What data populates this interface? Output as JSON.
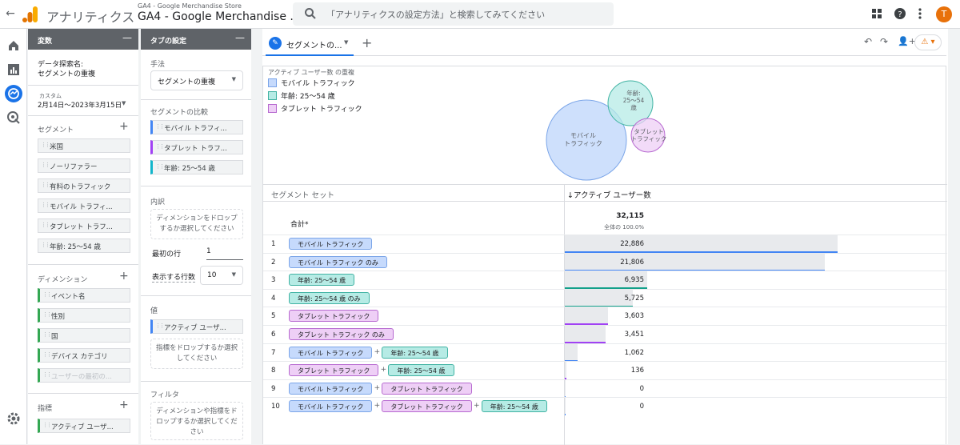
{
  "topbar": {
    "back_icon": "arrow-back-icon",
    "app_name": "アナリティクス",
    "property_sub": "GA4 - Google Merchandise Store",
    "property_main": "GA4 - Google Merchandise ...",
    "search_placeholder": "「アナリティクスの設定方法」と検索してみてください",
    "icons": [
      "apps-grid-icon",
      "help-icon",
      "more-vert-icon"
    ],
    "avatar_letter": "T"
  },
  "nav": {
    "items": [
      "home-icon",
      "reports-icon",
      "explore-icon",
      "advertising-icon"
    ],
    "active": "explore-icon",
    "bottom": "settings-icon"
  },
  "variables_panel": {
    "title": "変数",
    "minimize": "—",
    "exploration_name_label": "データ探索名:",
    "exploration_name": "セグメントの重複",
    "date_label": "カスタム",
    "date_range": "2月14日～2023年3月15日",
    "segments_label": "セグメント",
    "segments": [
      "米国",
      "ノーリファラー",
      "有料のトラフィック",
      "モバイル トラフィ...",
      "タブレット トラフ...",
      "年齢: 25～54 歳"
    ],
    "dimensions_label": "ディメンション",
    "dimensions": [
      "イベント名",
      "性別",
      "国",
      "デバイス カテゴリ",
      "ユーザーの最初の..."
    ],
    "metrics_label": "指標",
    "metrics": [
      "アクティブ ユーザ..."
    ]
  },
  "tab_settings_panel": {
    "title": "タブの設定",
    "minimize": "—",
    "technique_label": "手法",
    "technique_value": "セグメントの重複",
    "segment_compare_label": "セグメントの比較",
    "segment_compare": [
      "モバイル トラフィ...",
      "タブレット トラフ...",
      "年齢: 25～54 歳"
    ],
    "breakdown_label": "内訳",
    "breakdown_drop": "ディメンションをドロップするか選択してください",
    "start_row_label": "最初の行",
    "start_row_value": "1",
    "show_rows_label": "表示する行数",
    "show_rows_value": "10",
    "values_label": "値",
    "values_metric": "アクティブ ユーザ...",
    "values_drop": "指標をドロップするか選択してください",
    "filter_label": "フィルタ",
    "filter_drop": "ディメンションや指標をドロップするか選択してください"
  },
  "tabs": {
    "active_label": "セグメントの...",
    "add_icon": "add-icon",
    "actions": [
      "undo-icon",
      "redo-icon",
      "share-user-icon",
      "warning-icon"
    ]
  },
  "venn": {
    "legend_title": "アクティブ ユーザー数 の重複",
    "legend": [
      {
        "label": "モバイル トラフィック",
        "fill": "#c6dafc",
        "stroke": "#7ba5e8"
      },
      {
        "label": "年齢: 25～54 歳",
        "fill": "#b6ebe5",
        "stroke": "#41b3a3"
      },
      {
        "label": "タブレット トラフィック",
        "fill": "#eecff6",
        "stroke": "#b76ad0"
      }
    ],
    "circle_labels": {
      "mobile": [
        "モバイル",
        "トラフィック"
      ],
      "age": [
        "年齢:",
        "25～54",
        "歳"
      ],
      "tablet": [
        "タブレット",
        "トラフィック"
      ]
    }
  },
  "table": {
    "col_segment": "セグメント セット",
    "col_metric": "↓アクティブ ユーザー数",
    "total_label": "合計*",
    "total_value": "32,115",
    "total_sub": "全体の 100.0%",
    "max": 32115,
    "rows": [
      {
        "n": "1",
        "segs": [
          {
            "t": "モバイル トラフィック",
            "c": "b"
          }
        ],
        "value": "22,886",
        "v": 22886,
        "bar": "b"
      },
      {
        "n": "2",
        "segs": [
          {
            "t": "モバイル トラフィック のみ",
            "c": "b"
          }
        ],
        "value": "21,806",
        "v": 21806,
        "bar": "b"
      },
      {
        "n": "3",
        "segs": [
          {
            "t": "年齢: 25～54 歳",
            "c": "t"
          }
        ],
        "value": "6,935",
        "v": 6935,
        "bar": "t"
      },
      {
        "n": "4",
        "segs": [
          {
            "t": "年齢: 25～54 歳 のみ",
            "c": "t"
          }
        ],
        "value": "5,725",
        "v": 5725,
        "bar": "t"
      },
      {
        "n": "5",
        "segs": [
          {
            "t": "タブレット トラフィック",
            "c": "p"
          }
        ],
        "value": "3,603",
        "v": 3603,
        "bar": "p"
      },
      {
        "n": "6",
        "segs": [
          {
            "t": "タブレット トラフィック のみ",
            "c": "p"
          }
        ],
        "value": "3,451",
        "v": 3451,
        "bar": "p"
      },
      {
        "n": "7",
        "segs": [
          {
            "t": "モバイル トラフィック",
            "c": "b"
          },
          {
            "t": "年齢: 25～54 歳",
            "c": "t"
          }
        ],
        "value": "1,062",
        "v": 1062,
        "bar": "b"
      },
      {
        "n": "8",
        "segs": [
          {
            "t": "タブレット トラフィック",
            "c": "p"
          },
          {
            "t": "年齢: 25～54 歳",
            "c": "t"
          }
        ],
        "value": "136",
        "v": 136,
        "bar": "p"
      },
      {
        "n": "9",
        "segs": [
          {
            "t": "モバイル トラフィック",
            "c": "b"
          },
          {
            "t": "タブレット トラフィック",
            "c": "p"
          }
        ],
        "value": "0",
        "v": 0,
        "bar": "b"
      },
      {
        "n": "10",
        "segs": [
          {
            "t": "モバイル トラフィック",
            "c": "b"
          },
          {
            "t": "タブレット トラフィック",
            "c": "p"
          },
          {
            "t": "年齢: 25～54 歳",
            "c": "t"
          }
        ],
        "value": "0",
        "v": 0,
        "bar": "b"
      }
    ],
    "operator": "+"
  }
}
